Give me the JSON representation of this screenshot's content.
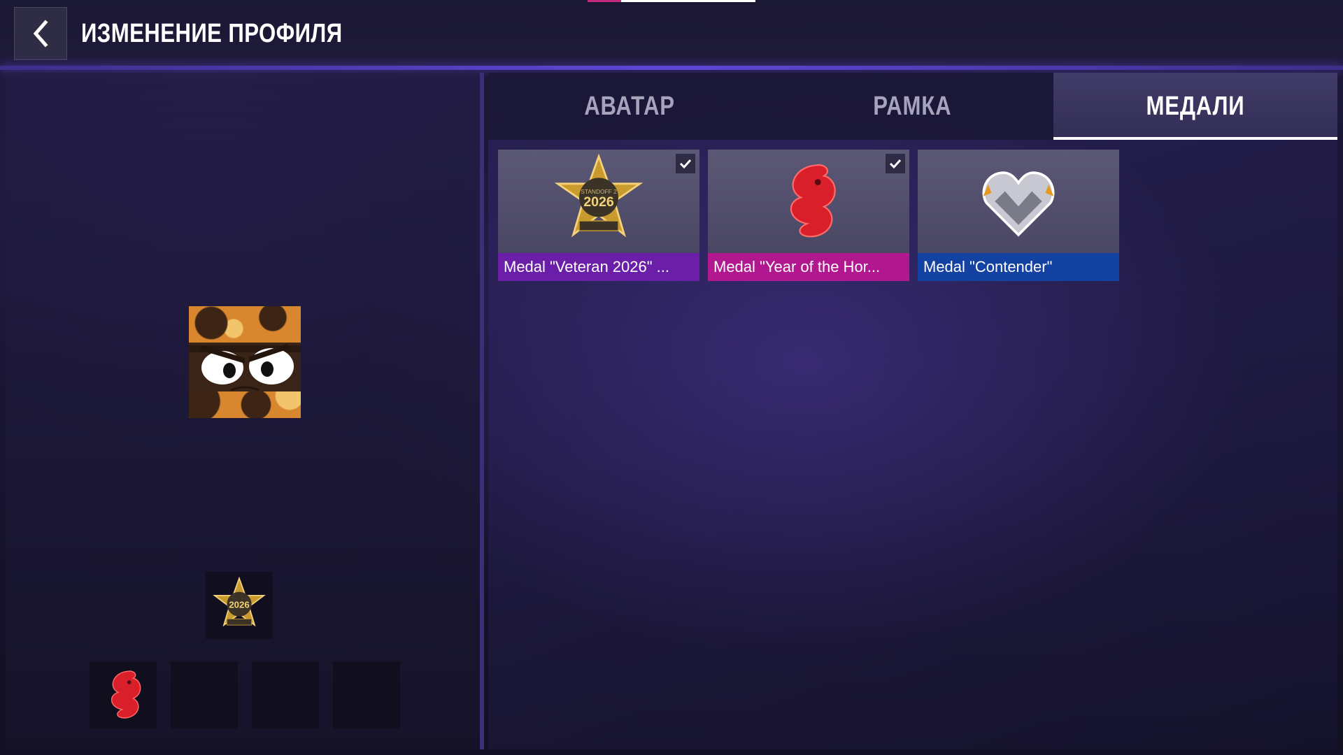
{
  "header": {
    "title": "ИЗМЕНЕНИЕ ПРОФИЛЯ",
    "back_icon": "chevron-left-icon"
  },
  "preview": {
    "avatar_icon": "camo-ninja-avatar",
    "main_medal_icon": "veteran-2026-medal-icon",
    "slots": [
      {
        "icon": "horse-medal-icon",
        "filled": true
      },
      {
        "filled": false
      },
      {
        "filled": false
      },
      {
        "filled": false
      }
    ]
  },
  "tabs": [
    {
      "label": "АВАТАР",
      "active": false
    },
    {
      "label": "РАМКА",
      "active": false
    },
    {
      "label": "МЕДАЛИ",
      "active": true
    }
  ],
  "medals": [
    {
      "label": "Medal \"Veteran 2026\" ...",
      "selected": true,
      "icon": "veteran-2026-medal-icon",
      "color": "#6b1fa8"
    },
    {
      "label": "Medal \"Year of the Hor...",
      "selected": true,
      "icon": "horse-medal-icon",
      "color": "#b1178f"
    },
    {
      "label": "Medal \"Contender\"",
      "selected": false,
      "icon": "contender-medal-icon",
      "color": "#1442a3"
    }
  ],
  "colors": {
    "accent": "#6046d6",
    "background": "#151327"
  }
}
